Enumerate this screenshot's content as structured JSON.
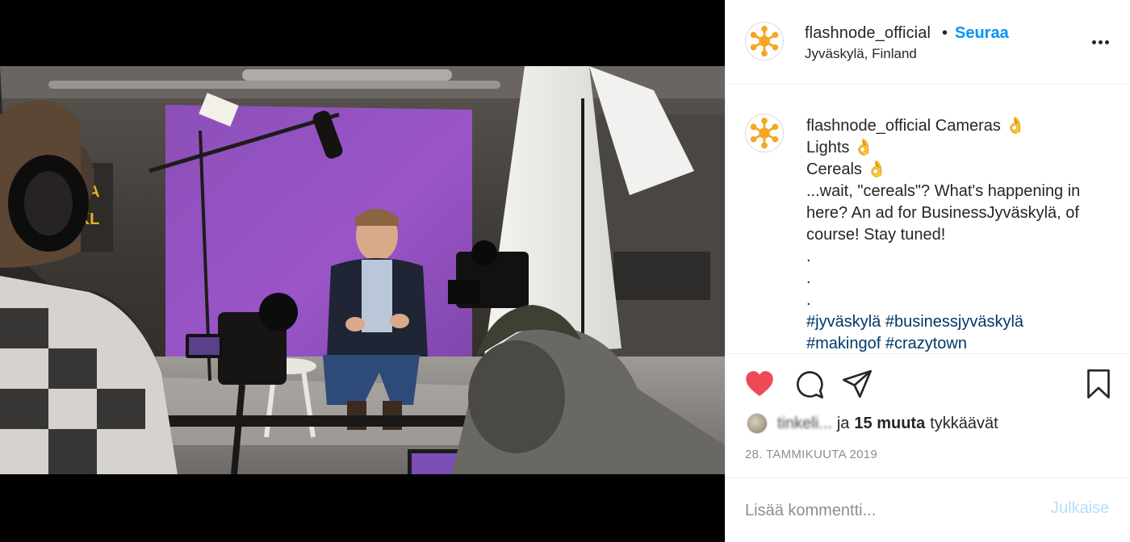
{
  "post": {
    "username": "flashnode_official",
    "follow_label": "Seuraa",
    "separator": "•",
    "location": "Jyväskylä, Finland"
  },
  "caption": {
    "username": "flashnode_official",
    "lines": [
      "Cameras 👌",
      "Lights 👌",
      "Cereals 👌",
      "...wait, \"cereals\"? What's happening in here? An ad for BusinessJyväskylä, of course! Stay tuned!",
      ".",
      ".",
      "."
    ],
    "hashtags": [
      "#jyväskylä",
      "#businessjyväskylä",
      "#makingof",
      "#crazytown"
    ]
  },
  "likes": {
    "liker": "tinkeli...",
    "conjunction": "ja",
    "count_label": "15 muuta",
    "suffix": "tykkäävät"
  },
  "date": "28. TAMMIKUUTA 2019",
  "comment": {
    "placeholder": "Lisää kommentti...",
    "post_label": "Julkaise"
  },
  "icons": {
    "like": "heart-icon",
    "comment": "comment-icon",
    "share": "share-icon",
    "save": "bookmark-icon",
    "more": "more-icon"
  },
  "colors": {
    "like_active": "#ed4956",
    "link": "#0095f6",
    "hashtag": "#00376b",
    "post_disabled": "#b2dffc",
    "avatar_accent": "#f5a623"
  }
}
